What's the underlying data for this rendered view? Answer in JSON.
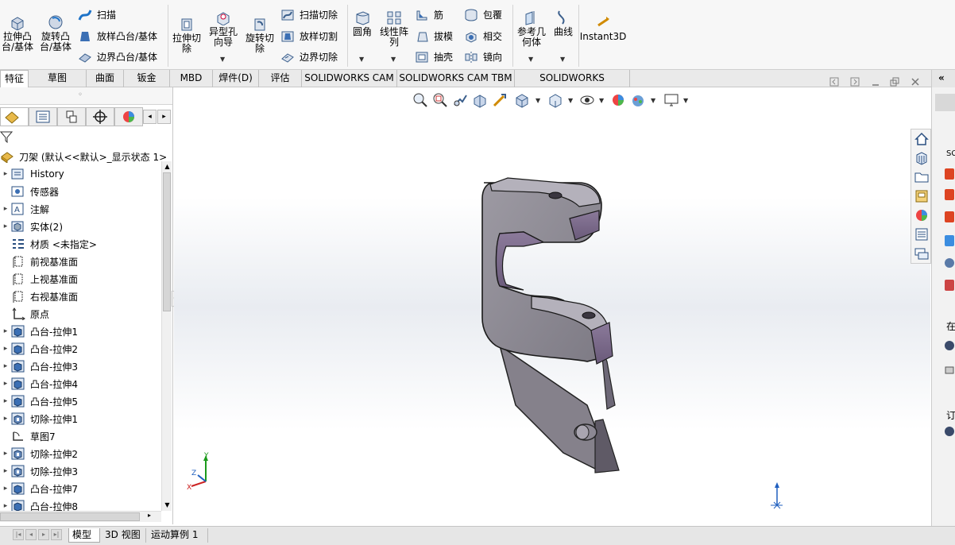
{
  "ribbon": {
    "extrude_boss": "拉伸凸\n台/基体",
    "revolve_boss": "旋转凸\n台/基体",
    "sweep": "扫描",
    "loft_boss": "放样凸台/基体",
    "boundary_boss": "边界凸台/基体",
    "extrude_cut": "拉伸切\n除",
    "hole_wizard": "异型孔\n向导",
    "revolve_cut": "旋转切\n除",
    "sweep_cut": "扫描切除",
    "loft_cut": "放样切割",
    "boundary_cut": "边界切除",
    "fillet": "圆角",
    "linear_pattern": "线性阵\n列",
    "rib": "筋",
    "draft": "拔模",
    "shell": "抽壳",
    "wrap": "包覆",
    "intersect": "相交",
    "mirror": "镜向",
    "reference_geometry": "参考几\n何体",
    "curves": "曲线",
    "instant3d": "Instant3D"
  },
  "tabs": [
    "特征",
    "草图",
    "曲面",
    "钣金",
    "MBD",
    "焊件(D)",
    "评估",
    "SOLIDWORKS CAM",
    "SOLIDWORKS CAM TBM",
    "SOLIDWORKS Inspection"
  ],
  "tree": {
    "root": "刀架 (默认<<默认>_显示状态 1>",
    "items": [
      {
        "label": "History",
        "icon": "history-icon",
        "toggle": "▸"
      },
      {
        "label": "传感器",
        "icon": "sensor-icon",
        "toggle": ""
      },
      {
        "label": "注解",
        "icon": "annotation-icon",
        "toggle": "▸"
      },
      {
        "label": "实体(2)",
        "icon": "solid-bodies-icon",
        "toggle": "▸"
      },
      {
        "label": "材质 <未指定>",
        "icon": "material-icon",
        "toggle": ""
      },
      {
        "label": "前视基准面",
        "icon": "plane-icon",
        "toggle": ""
      },
      {
        "label": "上视基准面",
        "icon": "plane-icon",
        "toggle": ""
      },
      {
        "label": "右视基准面",
        "icon": "plane-icon",
        "toggle": ""
      },
      {
        "label": "原点",
        "icon": "origin-icon",
        "toggle": ""
      },
      {
        "label": "凸台-拉伸1",
        "icon": "extrude-feature-icon",
        "toggle": "▸"
      },
      {
        "label": "凸台-拉伸2",
        "icon": "extrude-feature-icon",
        "toggle": "▸"
      },
      {
        "label": "凸台-拉伸3",
        "icon": "extrude-feature-icon",
        "toggle": "▸"
      },
      {
        "label": "凸台-拉伸4",
        "icon": "extrude-feature-icon",
        "toggle": "▸"
      },
      {
        "label": "凸台-拉伸5",
        "icon": "extrude-feature-icon",
        "toggle": "▸"
      },
      {
        "label": "切除-拉伸1",
        "icon": "cut-feature-icon",
        "toggle": "▸"
      },
      {
        "label": "草图7",
        "icon": "sketch-icon",
        "toggle": ""
      },
      {
        "label": "切除-拉伸2",
        "icon": "cut-feature-icon",
        "toggle": "▸"
      },
      {
        "label": "切除-拉伸3",
        "icon": "cut-feature-icon",
        "toggle": "▸"
      },
      {
        "label": "凸台-拉伸7",
        "icon": "extrude-feature-icon",
        "toggle": "▸"
      },
      {
        "label": "凸台-拉伸8",
        "icon": "extrude-feature-icon",
        "toggle": "▸"
      }
    ]
  },
  "bottom_tabs": [
    "模型",
    "3D 视图",
    "运动算例 1"
  ],
  "triad": {
    "x": "X",
    "y": "Y",
    "z": "Z"
  },
  "task_pane": {
    "label1": "SC",
    "label2": "在",
    "label3": "订"
  },
  "colors": {
    "part_face": "#8f8b94",
    "part_cut": "#7a6a88",
    "accent": "#1f5fbf"
  }
}
